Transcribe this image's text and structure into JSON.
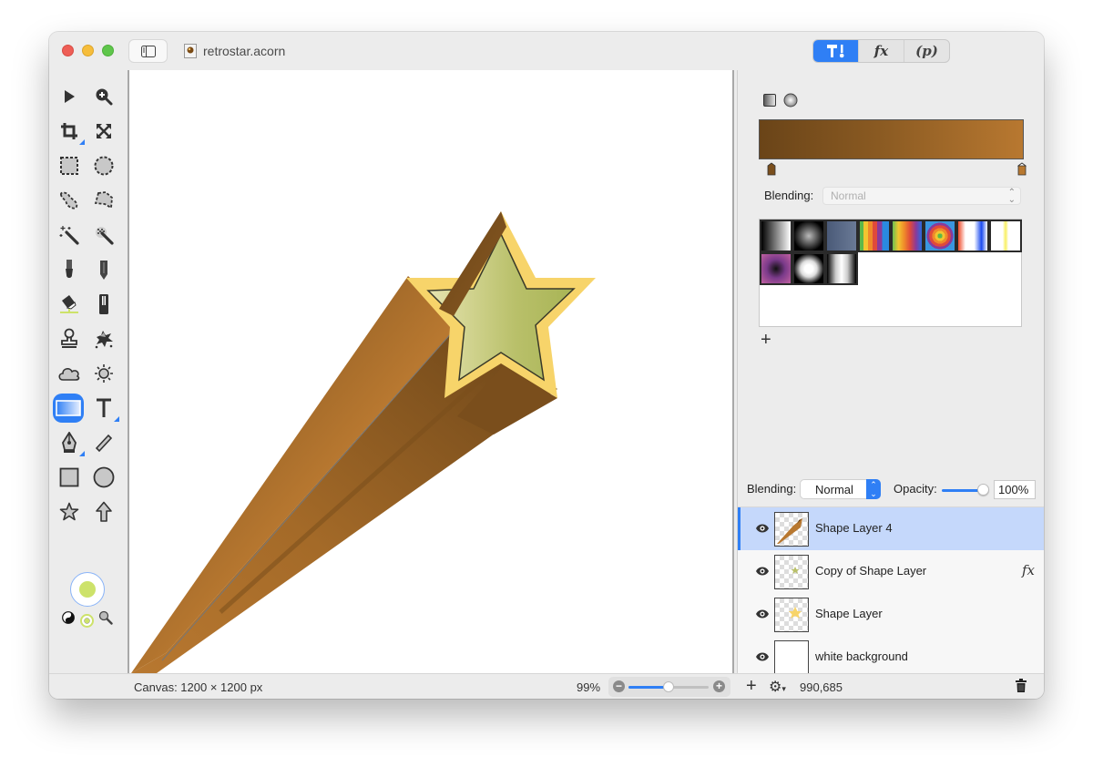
{
  "window": {
    "title": "retrostar.acorn",
    "traffic_lights": [
      "close",
      "minimize",
      "zoom"
    ]
  },
  "inspector_tabs": [
    {
      "id": "tools",
      "label": "",
      "icon": "hammer-brush-icon",
      "active": true
    },
    {
      "id": "filters",
      "label": "fx",
      "active": false
    },
    {
      "id": "properties",
      "label": "(p)",
      "active": false
    }
  ],
  "toolbox": {
    "tools": [
      {
        "name": "select-tool",
        "icon": "arrow-pointer-icon"
      },
      {
        "name": "zoom-tool",
        "icon": "magnifier-plus-icon"
      },
      {
        "name": "crop-tool",
        "icon": "crop-icon",
        "has_submenu": true
      },
      {
        "name": "transform-tool",
        "icon": "expand-arrows-icon"
      },
      {
        "name": "rect-select-tool",
        "icon": "dashed-rect-icon"
      },
      {
        "name": "ellipse-select-tool",
        "icon": "dashed-circle-icon"
      },
      {
        "name": "lasso-tool",
        "icon": "lasso-icon"
      },
      {
        "name": "polygon-lasso-tool",
        "icon": "polygon-lasso-icon"
      },
      {
        "name": "magic-wand-tool",
        "icon": "magic-wand-icon"
      },
      {
        "name": "instant-alpha-tool",
        "icon": "instant-alpha-icon"
      },
      {
        "name": "brush-tool",
        "icon": "brush-icon"
      },
      {
        "name": "pencil-tool",
        "icon": "pencil-icon"
      },
      {
        "name": "paint-bucket-tool",
        "icon": "paint-bucket-icon"
      },
      {
        "name": "eraser-tool",
        "icon": "eraser-icon"
      },
      {
        "name": "clone-tool",
        "icon": "stamp-icon"
      },
      {
        "name": "smudge-tool",
        "icon": "splat-icon"
      },
      {
        "name": "shape-cloud-tool",
        "icon": "cloud-icon"
      },
      {
        "name": "brightness-tool",
        "icon": "sun-icon"
      },
      {
        "name": "gradient-tool",
        "icon": "gradient-icon",
        "active": true
      },
      {
        "name": "text-tool",
        "icon": "text-t-icon",
        "has_submenu": true
      },
      {
        "name": "pen-tool",
        "icon": "pen-nib-icon",
        "has_submenu": true
      },
      {
        "name": "line-tool",
        "icon": "line-icon"
      },
      {
        "name": "rectangle-tool",
        "icon": "rectangle-icon"
      },
      {
        "name": "oval-tool",
        "icon": "circle-icon"
      },
      {
        "name": "star-tool",
        "icon": "star-icon"
      },
      {
        "name": "arrow-tool",
        "icon": "arrow-up-icon"
      }
    ],
    "fill_color": "#cde26a",
    "stroke_color": "#cde26a"
  },
  "gradient": {
    "types": [
      "linear",
      "radial"
    ],
    "start_color": "#6a4418",
    "end_color": "#b87830",
    "blending_label": "Blending:",
    "blending_value": "Normal",
    "presets": [
      "black-white",
      "radial-gray",
      "slate-blue",
      "rainbow-stripes",
      "rainbow-smooth",
      "concentric-rainbow",
      "red-white-blue",
      "white-yellow-transparent",
      "purple-radial",
      "white-radial",
      "silver-bands"
    ]
  },
  "layers_panel": {
    "blending_label": "Blending:",
    "blending_value": "Normal",
    "opacity_label": "Opacity:",
    "opacity_value": "100%",
    "opacity_fraction": 1.0,
    "layers": [
      {
        "name": "Shape Layer 4",
        "visible": true,
        "selected": true,
        "fx": false,
        "thumb": "comet-tail"
      },
      {
        "name": "Copy of Shape Layer",
        "visible": true,
        "selected": false,
        "fx": true,
        "thumb": "small-green-star"
      },
      {
        "name": "Shape Layer",
        "visible": true,
        "selected": false,
        "fx": false,
        "thumb": "small-yellow-star"
      },
      {
        "name": "white background",
        "visible": true,
        "selected": false,
        "fx": false,
        "thumb": "white"
      }
    ],
    "fx_label": "fx"
  },
  "statusbar": {
    "canvas_size": "Canvas: 1200 × 1200 px",
    "zoom_percent": "99%",
    "zoom_fraction": 0.5,
    "coordinates": "990,685"
  }
}
